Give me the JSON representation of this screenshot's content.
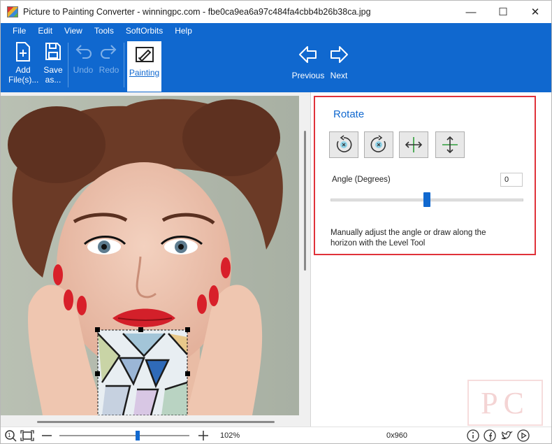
{
  "window": {
    "title": "Picture to Painting Converter - winningpc.com - fbe0ca9ea6a97c484fa4cbb4b26b38ca.jpg",
    "minimize_glyph": "—",
    "maximize_glyph": "☐",
    "close_glyph": "✕"
  },
  "menu": [
    "File",
    "Edit",
    "View",
    "Tools",
    "SoftOrbits",
    "Help"
  ],
  "toolbar": {
    "add_files": "Add File(s)...",
    "save_as": "Save as...",
    "undo": "Undo",
    "redo": "Redo",
    "painting": "Painting",
    "previous": "Previous",
    "next": "Next"
  },
  "rotate": {
    "title": "Rotate",
    "angle_label": "Angle (Degrees)",
    "angle_value": "0",
    "angle_slider_fraction": 0.5,
    "hint": "Manually adjust the angle or draw along the horizon with the Level Tool",
    "buttons": [
      "rotate-ccw-icon",
      "rotate-cw-icon",
      "flip-horizontal-icon",
      "flip-vertical-icon"
    ]
  },
  "status": {
    "zoom": "102%",
    "dimensions": "0x960",
    "zoom_slider_fraction": 0.6
  },
  "watermark": "PC",
  "colors": {
    "accent": "#1068cf",
    "highlight_border": "#e0323a"
  }
}
